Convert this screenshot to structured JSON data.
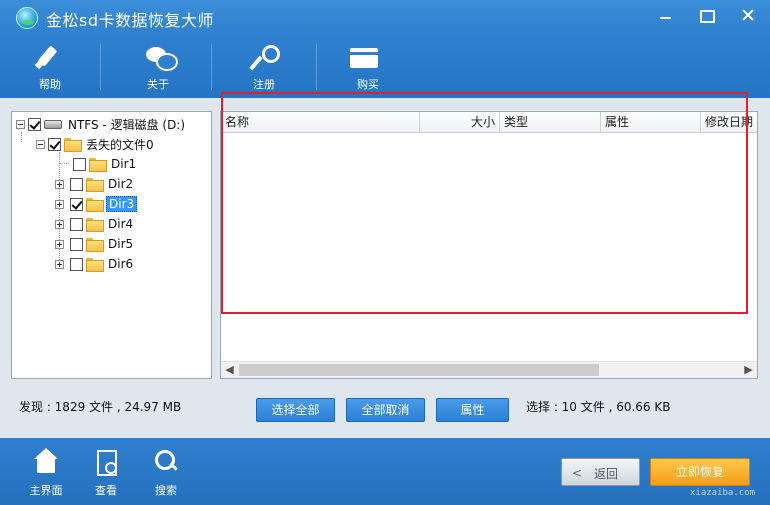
{
  "window": {
    "title": "金松sd卡数据恢复大师"
  },
  "toolbar": {
    "items": [
      {
        "label": "帮助",
        "icon": "pencil-icon"
      },
      {
        "label": "关于",
        "icon": "chat-bubbles-icon"
      },
      {
        "label": "注册",
        "icon": "key-icon"
      },
      {
        "label": "购买",
        "icon": "card-icon"
      }
    ]
  },
  "tree": {
    "root": "NTFS - 逻辑磁盘 (D:)",
    "lost": "丢失的文件0",
    "dirs": [
      "Dir1",
      "Dir2",
      "Dir3",
      "Dir4",
      "Dir5",
      "Dir6"
    ],
    "selected": "Dir3"
  },
  "list": {
    "columns": [
      "名称",
      "大小",
      "类型",
      "属性",
      "修改日期"
    ]
  },
  "status": {
    "found": "发现 : 1829 文件 , 24.97 MB",
    "selected": "选择 : 10 文件 , 60.66 KB"
  },
  "buttons": {
    "select_all": "选择全部",
    "deselect_all": "全部取消",
    "properties": "属性"
  },
  "bottom": {
    "home": "主界面",
    "view": "查看",
    "search": "搜索",
    "back": "返回",
    "back_arrow": "<",
    "next": "立即恢复"
  },
  "watermark": "xiazaiba.com",
  "colors": {
    "accent": "#2f80cf",
    "highlight": "#e0202a",
    "primary_button": "#f49d1a"
  }
}
